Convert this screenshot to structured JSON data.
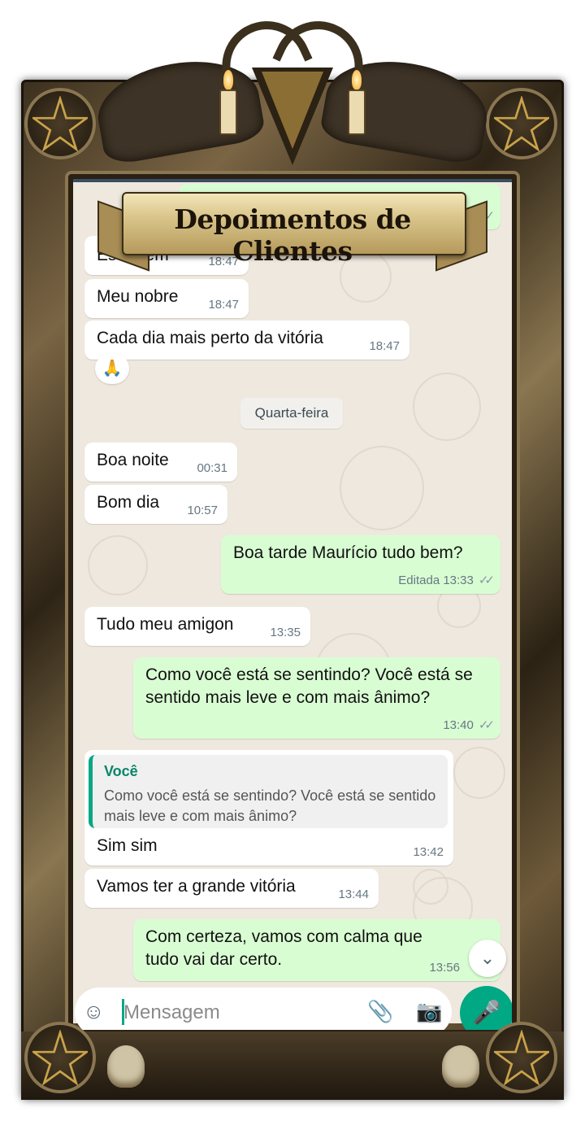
{
  "banner": {
    "title": "Depoimentos de Clientes"
  },
  "date_chip": "Quarta-feira",
  "reaction": "🙏",
  "messages": [
    {
      "dir": "out",
      "text": "",
      "time": "",
      "ticks": "✓✓"
    },
    {
      "dir": "in",
      "text": "Está bem",
      "time": "18:47"
    },
    {
      "dir": "in",
      "text": "Meu nobre",
      "time": "18:47"
    },
    {
      "dir": "in",
      "text": "Cada dia mais perto da vitória",
      "time": "18:47"
    },
    {
      "dir": "in",
      "text": "Boa noite",
      "time": "00:31"
    },
    {
      "dir": "in",
      "text": "Bom dia",
      "time": "10:57"
    },
    {
      "dir": "out",
      "text": "Boa tarde Maurício tudo bem?",
      "time": "Editada 13:33",
      "ticks": "✓✓"
    },
    {
      "dir": "in",
      "text": "Tudo meu amigon",
      "time": "13:35"
    },
    {
      "dir": "out",
      "text": "Como você está se sentindo? Você está se sentido mais leve e com mais ânimo?",
      "time": "13:40",
      "ticks": "✓✓"
    },
    {
      "dir": "in",
      "text": "Sim sim",
      "time": "13:42",
      "quote": {
        "author": "Você",
        "text": "Como você está se sentindo? Você está se sentido mais leve e com mais ânimo?"
      }
    },
    {
      "dir": "in",
      "text": "Vamos ter a grande vitória",
      "time": "13:44"
    },
    {
      "dir": "out",
      "text": "Com certeza, vamos com calma que tudo vai dar certo.",
      "time": "13:56"
    }
  ],
  "input": {
    "placeholder": "Mensagem"
  },
  "icons": {
    "emoji": "emoji-icon",
    "attach": "paperclip-icon",
    "camera": "camera-icon",
    "mic": "microphone-icon",
    "scroll": "chevron-double-down-icon"
  },
  "colors": {
    "outgoing": "#d9fdd3",
    "incoming": "#ffffff",
    "accent": "#00a884",
    "chat_bg": "#efe8de"
  }
}
